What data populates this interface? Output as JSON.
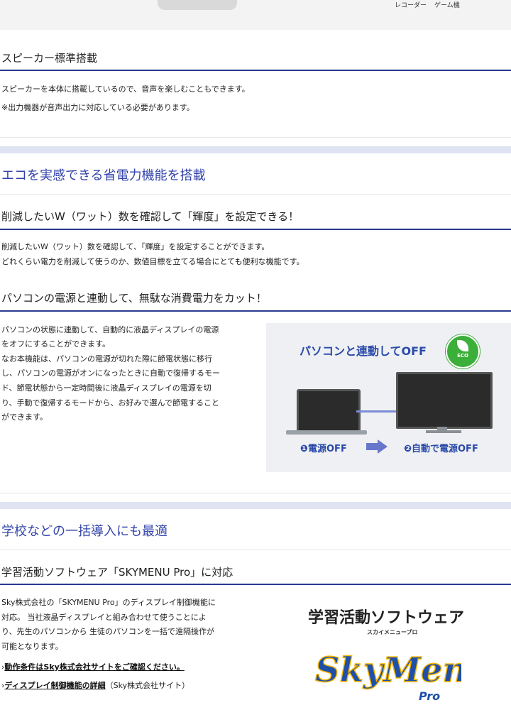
{
  "top": {
    "captions": [
      "レコーダー",
      "ゲーム機"
    ]
  },
  "speaker": {
    "heading": "スピーカー標準搭載",
    "lines": [
      "スピーカーを本体に搭載しているので、音声を楽しむこともできます。",
      "※出力機器が音声出力に対応している必要があります。"
    ]
  },
  "eco": {
    "section_title": "エコを実感できる省電力機能を搭載",
    "watt": {
      "heading": "削減したいW（ワット）数を確認して「輝度」を設定できる！",
      "lines": [
        "削減したいW（ワット）数を確認して、「輝度」を設定することができます。",
        "どれくらい電力を削減して使うのか、数値目標を立てる場合にとても便利な機能です。"
      ]
    },
    "pc_link": {
      "heading": "パソコンの電源と連動して、無駄な消費電力をカット！",
      "lines": [
        "パソコンの状態に連動して、自動的に液晶ディスプレイの電源",
        "をオフにすることができます。",
        "なお本機能は、パソコンの電源が切れた際に節電状態に移行",
        "し、パソコンの電源がオンになったときに自動で復帰するモー",
        "ド、節電状態から一定時間後に液晶ディスプレイの電源を切",
        "り、手動で復帰するモードから、お好みで選んで節電すること",
        "ができます。"
      ],
      "illustration": {
        "title": "パソコンと連動してOFF",
        "badge": "ECO",
        "step1": "❶電源OFF",
        "step2": "❷自動で電源OFF"
      }
    }
  },
  "school": {
    "section_title": "学校などの一括導入にも最適",
    "skymenu": {
      "heading": "学習活動ソフトウェア「SKYMENU Pro」に対応",
      "lines": [
        "Sky株式会社の「SKYMENU Pro」のディスプレイ制御機能に",
        "対応。 当社液晶ディスプレイと組み合わせて使うことによ",
        "り、先生のパソコンから 生徒のパソコンを一括で遠隔操作が",
        "可能となります。"
      ],
      "link1": "動作条件はSky株式会社サイトをご確認ください。",
      "link2": "ディスプレイ制御機能の詳細",
      "link2_suffix": "（Sky株式会社サイト）",
      "logo_title": "学習活動ソフトウェア",
      "logo_sub": "スカイメニュープロ",
      "logo_word": "SkyMenu",
      "logo_pro": "Pro"
    }
  }
}
